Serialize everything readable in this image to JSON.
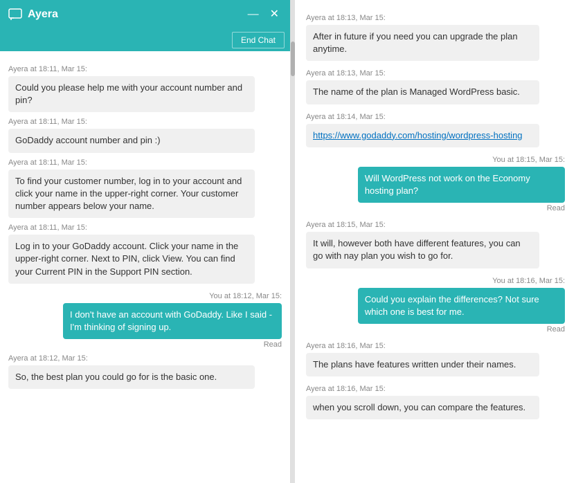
{
  "header": {
    "title": "Ayera",
    "minimize_label": "—",
    "close_label": "✕",
    "chat_icon": "💬"
  },
  "top_bar": {
    "end_chat_label": "End Chat"
  },
  "left_messages": [
    {
      "id": "lm1",
      "timestamp": "Ayera at 18:11, Mar 15:",
      "text": "Could you please help me with your account number and pin?",
      "type": "agent"
    },
    {
      "id": "lm2",
      "timestamp": "Ayera at 18:11, Mar 15:",
      "text": "GoDaddy account number and pin :)",
      "type": "agent"
    },
    {
      "id": "lm3",
      "timestamp": "Ayera at 18:11, Mar 15:",
      "text": "To find your customer number, log in to your account and click your name in the upper-right corner. Your customer number appears below your name.",
      "type": "agent"
    },
    {
      "id": "lm4",
      "timestamp": "Ayera at 18:11, Mar 15:",
      "text": "Log in to your GoDaddy account. Click your name in the upper-right corner. Next to PIN, click View. You can find your Current PIN in the Support PIN section.",
      "type": "agent"
    },
    {
      "id": "lm5",
      "timestamp": "You at 18:12, Mar 15:",
      "text": "I don't have an account with GoDaddy. Like I said - I'm thinking of signing up.",
      "type": "user",
      "read": "Read"
    },
    {
      "id": "lm6",
      "timestamp": "Ayera at 18:12, Mar 15:",
      "text": "So, the best plan you could go for is the basic one.",
      "type": "agent"
    }
  ],
  "right_messages": [
    {
      "id": "rm1",
      "timestamp": "Ayera at 18:13, Mar 15:",
      "text": "After in future if you need you can upgrade the plan anytime.",
      "type": "agent"
    },
    {
      "id": "rm2",
      "timestamp": "Ayera at 18:13, Mar 15:",
      "text": "The name of the plan is Managed WordPress basic.",
      "type": "agent"
    },
    {
      "id": "rm3",
      "timestamp": "Ayera at 18:14, Mar 15:",
      "text": "https://www.godaddy.com/hosting/wordpress-hosting",
      "type": "agent",
      "is_link": true
    },
    {
      "id": "rm4",
      "timestamp": "You at 18:15, Mar 15:",
      "text": "Will WordPress not work on the Economy hosting plan?",
      "type": "user",
      "read": "Read"
    },
    {
      "id": "rm5",
      "timestamp": "Ayera at 18:15, Mar 15:",
      "text": "It will, however both have different features, you can go with nay plan you wish to go for.",
      "type": "agent"
    },
    {
      "id": "rm6",
      "timestamp": "You at 18:16, Mar 15:",
      "text": "Could you explain the differences? Not sure which one is best for me.",
      "type": "user",
      "read": "Read"
    },
    {
      "id": "rm7",
      "timestamp": "Ayera at 18:16, Mar 15:",
      "text": "The plans have features written under their names.",
      "type": "agent"
    },
    {
      "id": "rm8",
      "timestamp": "Ayera at 18:16, Mar 15:",
      "text": "when you scroll down, you can compare the features.",
      "type": "agent"
    }
  ]
}
